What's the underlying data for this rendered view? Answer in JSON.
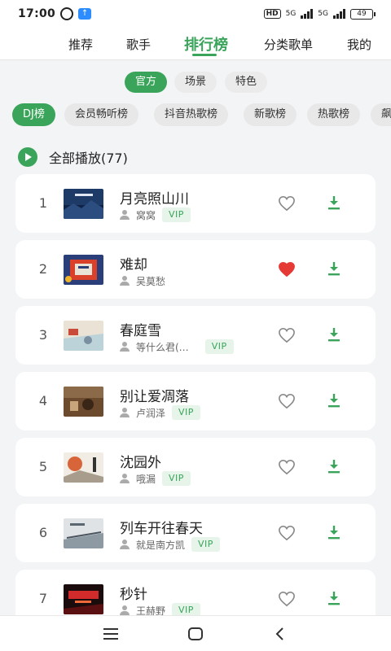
{
  "status_bar": {
    "time": "17:00",
    "network_1": "5G",
    "network_2": "5G",
    "hd": "HD",
    "battery": "49"
  },
  "top_nav": {
    "tabs": [
      {
        "label": "推荐",
        "active": false
      },
      {
        "label": "歌手",
        "active": false
      },
      {
        "label": "排行榜",
        "active": true
      },
      {
        "label": "分类歌单",
        "active": false
      },
      {
        "label": "我的",
        "active": false
      }
    ]
  },
  "sub_tabs": [
    {
      "label": "官方",
      "active": true
    },
    {
      "label": "场景",
      "active": false
    },
    {
      "label": "特色",
      "active": false
    }
  ],
  "chart_tabs": [
    {
      "label": "DJ榜",
      "active": true
    },
    {
      "label": "会员畅听榜",
      "active": false
    },
    {
      "label": "抖音热歌榜",
      "active": false
    },
    {
      "label": "新歌榜",
      "active": false
    },
    {
      "label": "热歌榜",
      "active": false
    },
    {
      "label": "飙",
      "active": false
    }
  ],
  "play_all": {
    "label": "全部播放(77)"
  },
  "songs": [
    {
      "rank": "1",
      "title": "月亮照山川",
      "artist": "窝窝",
      "vip": "VIP",
      "liked": false
    },
    {
      "rank": "2",
      "title": "难却",
      "artist": "吴莫愁",
      "vip": "",
      "liked": true
    },
    {
      "rank": "3",
      "title": "春庭雪",
      "artist": "等什么君(…",
      "vip": "VIP",
      "liked": false
    },
    {
      "rank": "4",
      "title": "别让爱凋落",
      "artist": "卢润泽",
      "vip": "VIP",
      "liked": false
    },
    {
      "rank": "5",
      "title": "沈园外",
      "artist": "哦漏",
      "vip": "VIP",
      "liked": false
    },
    {
      "rank": "6",
      "title": "列车开往春天",
      "artist": "就是南方凯",
      "vip": "VIP",
      "liked": false
    },
    {
      "rank": "7",
      "title": "秒针",
      "artist": "王赫野",
      "vip": "VIP",
      "liked": false
    }
  ],
  "colors": {
    "accent": "#3aa55a",
    "liked": "#e53935",
    "background": "#f3f4f6"
  }
}
